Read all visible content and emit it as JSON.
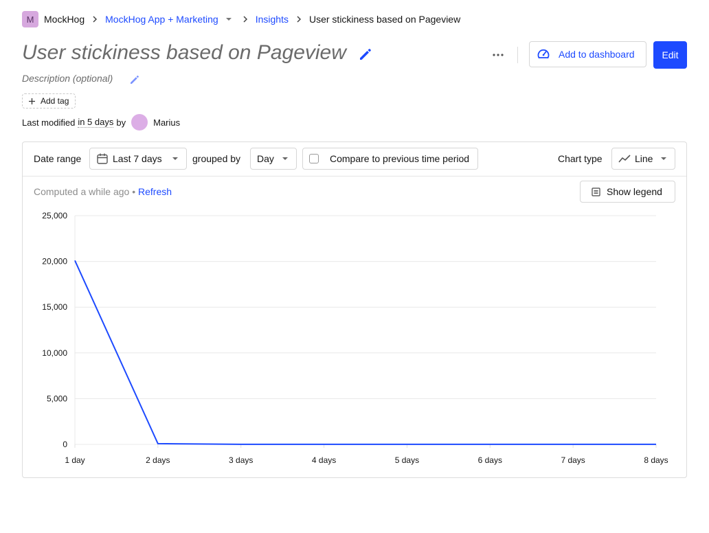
{
  "breadcrumbs": {
    "org_initial": "M",
    "org_name": "MockHog",
    "project": "MockHog App + Marketing",
    "section": "Insights",
    "current": "User stickiness based on Pageview"
  },
  "header": {
    "title": "User stickiness based on Pageview",
    "description_placeholder": "Description (optional)",
    "add_tag_label": "Add tag",
    "add_to_dashboard_label": "Add to dashboard",
    "edit_label": "Edit",
    "modified_prefix": "Last modified",
    "modified_when": "in 5 days",
    "modified_by_word": "by",
    "modified_user": "Marius"
  },
  "toolbar": {
    "date_range_label": "Date range",
    "date_range_value": "Last 7 days",
    "grouped_by_label": "grouped by",
    "interval_value": "Day",
    "compare_label": "Compare to previous time period",
    "compare_checked": false,
    "chart_type_label": "Chart type",
    "chart_type_value": "Line"
  },
  "status": {
    "computed_text": "Computed a while ago",
    "separator": "•",
    "refresh_label": "Refresh",
    "show_legend_label": "Show legend"
  },
  "colors": {
    "accent": "#1d4aff",
    "line": "#1d4aff"
  },
  "chart_data": {
    "type": "line",
    "categories": [
      "1 day",
      "2 days",
      "3 days",
      "4 days",
      "5 days",
      "6 days",
      "7 days",
      "8 days"
    ],
    "series": [
      {
        "values": [
          20100,
          80,
          10,
          5,
          5,
          5,
          5,
          5
        ]
      }
    ],
    "ylim": [
      0,
      25000
    ],
    "yticks": [
      0,
      5000,
      10000,
      15000,
      20000,
      25000
    ],
    "ytick_labels": [
      "0",
      "5,000",
      "10,000",
      "15,000",
      "20,000",
      "25,000"
    ],
    "grid": true,
    "legend": "hidden"
  }
}
